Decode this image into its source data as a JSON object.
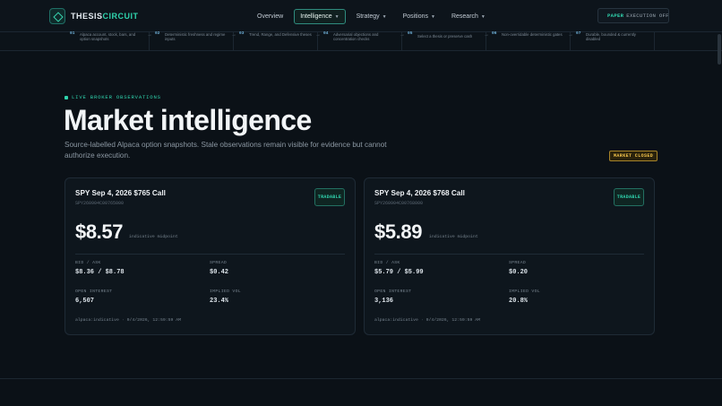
{
  "brand": {
    "name_part1": "THESIS",
    "name_part2": "CIRCUIT"
  },
  "nav": [
    {
      "label": "Overview",
      "has_dropdown": false,
      "active": false
    },
    {
      "label": "Intelligence",
      "has_dropdown": true,
      "active": true
    },
    {
      "label": "Strategy",
      "has_dropdown": true,
      "active": false
    },
    {
      "label": "Positions",
      "has_dropdown": true,
      "active": false
    },
    {
      "label": "Research",
      "has_dropdown": true,
      "active": false
    }
  ],
  "execution_toggle": {
    "mode": "PAPER",
    "status": "EXECUTION OFF"
  },
  "pipeline": [
    {
      "num": "01",
      "text": "Alpaca account, stock, bars, and option snapshots"
    },
    {
      "num": "02",
      "text": "Deterministic freshness and regime inputs"
    },
    {
      "num": "03",
      "text": "Trend, Range, and Defensive theses"
    },
    {
      "num": "04",
      "text": "Adversarial objections and concentration checks"
    },
    {
      "num": "05",
      "text": "Select a thesis or preserve cash"
    },
    {
      "num": "06",
      "text": "Non-overridable deterministic gates"
    },
    {
      "num": "07",
      "text": "Durable, bounded & currently disabled"
    }
  ],
  "hero": {
    "eyebrow": "LIVE BROKER OBSERVATIONS",
    "title": "Market intelligence",
    "subtitle": "Source-labelled Alpaca option snapshots. Stale observations remain visible for evidence but cannot authorize execution.",
    "market_status": "MARKET CLOSED"
  },
  "cards": [
    {
      "title": "SPY Sep 4, 2026 $765 Call",
      "symbol": "SPY260904C00765000",
      "badge": "TRADABLE",
      "price": "$8.57",
      "price_note": "indicative midpoint",
      "bid_ask_label": "BID / ASK",
      "bid_ask": "$8.36 / $8.78",
      "spread_label": "SPREAD",
      "spread": "$0.42",
      "oi_label": "OPEN INTEREST",
      "oi": "6,507",
      "iv_label": "IMPLIED VOL",
      "iv": "23.4%",
      "footer": "alpaca:indicative · 9/4/2026, 12:59:59 AM"
    },
    {
      "title": "SPY Sep 4, 2026 $768 Call",
      "symbol": "SPY260904C00768000",
      "badge": "TRADABLE",
      "price": "$5.89",
      "price_note": "indicative midpoint",
      "bid_ask_label": "BID / ASK",
      "bid_ask": "$5.79 / $5.99",
      "spread_label": "SPREAD",
      "spread": "$0.20",
      "oi_label": "OPEN INTEREST",
      "oi": "3,136",
      "iv_label": "IMPLIED VOL",
      "iv": "20.8%",
      "footer": "alpaca:indicative · 9/4/2026, 12:59:59 AM"
    }
  ],
  "colors": {
    "accent": "#2fd3ad",
    "warning": "#f0c14b",
    "background": "#0b1117"
  }
}
